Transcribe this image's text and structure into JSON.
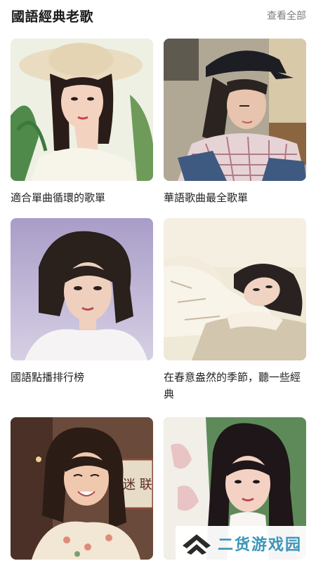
{
  "section": {
    "title": "國語經典老歌",
    "view_all": "查看全部"
  },
  "playlists": [
    {
      "title": "適合單曲循環的歌單",
      "cover_icon": "woman-straw-hat-portrait"
    },
    {
      "title": "華語歌曲最全歌單",
      "cover_icon": "woman-black-cap-portrait"
    },
    {
      "title": "國語點播排行榜",
      "cover_icon": "woman-short-hair-portrait"
    },
    {
      "title": "在春意盎然的季節，聽一些經典",
      "cover_icon": "woman-resting-on-table-portrait"
    },
    {
      "title": "",
      "cover_icon": "woman-smiling-portrait"
    },
    {
      "title": "",
      "cover_icon": "woman-long-hair-portrait"
    }
  ],
  "watermark": {
    "text": "二货游戏园",
    "color": "#3a96b8"
  }
}
